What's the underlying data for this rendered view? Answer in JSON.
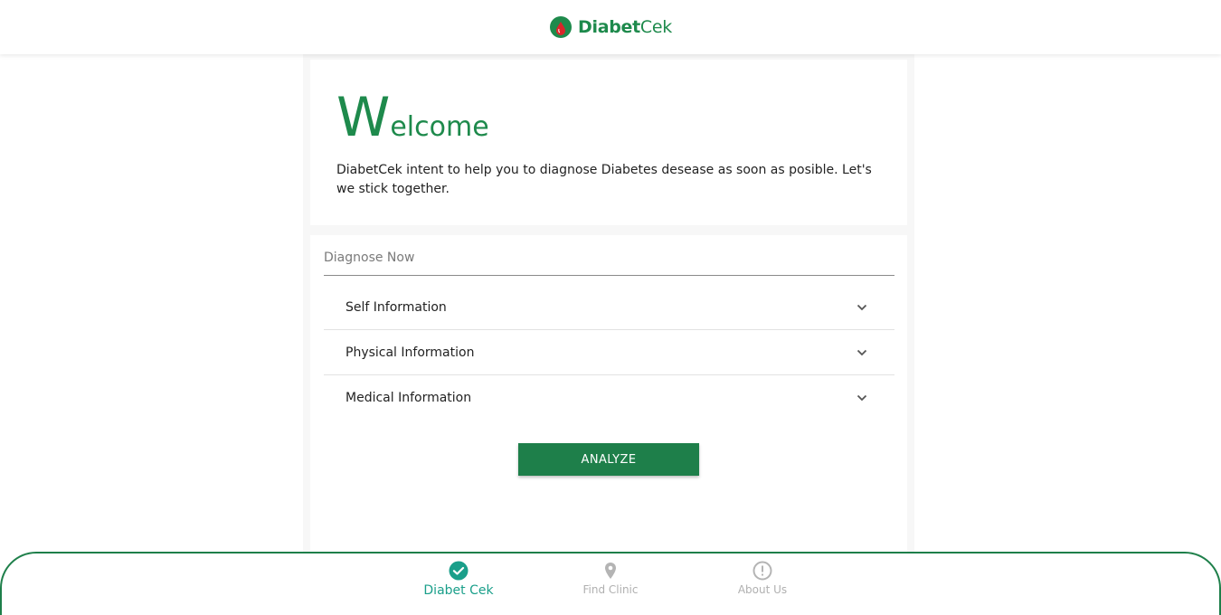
{
  "header": {
    "logo_part1": "Diabet",
    "logo_part2": "Cek"
  },
  "welcome": {
    "title_first": "W",
    "title_rest": "elcome",
    "text": "DiabetCek intent to help you to diagnose Diabetes desease as soon as posible. Let's we stick together."
  },
  "diagnose": {
    "label": "Diagnose Now",
    "sections": [
      {
        "label": "Self Information"
      },
      {
        "label": "Physical Information"
      },
      {
        "label": "Medical Information"
      }
    ],
    "analyze_label": "ANALYZE"
  },
  "bottom_nav": {
    "items": [
      {
        "label": "Diabet Cek",
        "icon": "check-circle-icon",
        "active": true
      },
      {
        "label": "Find Clinic",
        "icon": "location-pin-icon",
        "active": false
      },
      {
        "label": "About Us",
        "icon": "info-circle-icon",
        "active": false
      }
    ]
  },
  "colors": {
    "brand_green": "#1e8a4c",
    "button_green": "#1e7f4a",
    "active_teal": "#1a9f8a",
    "logo_red": "#d9252a"
  }
}
